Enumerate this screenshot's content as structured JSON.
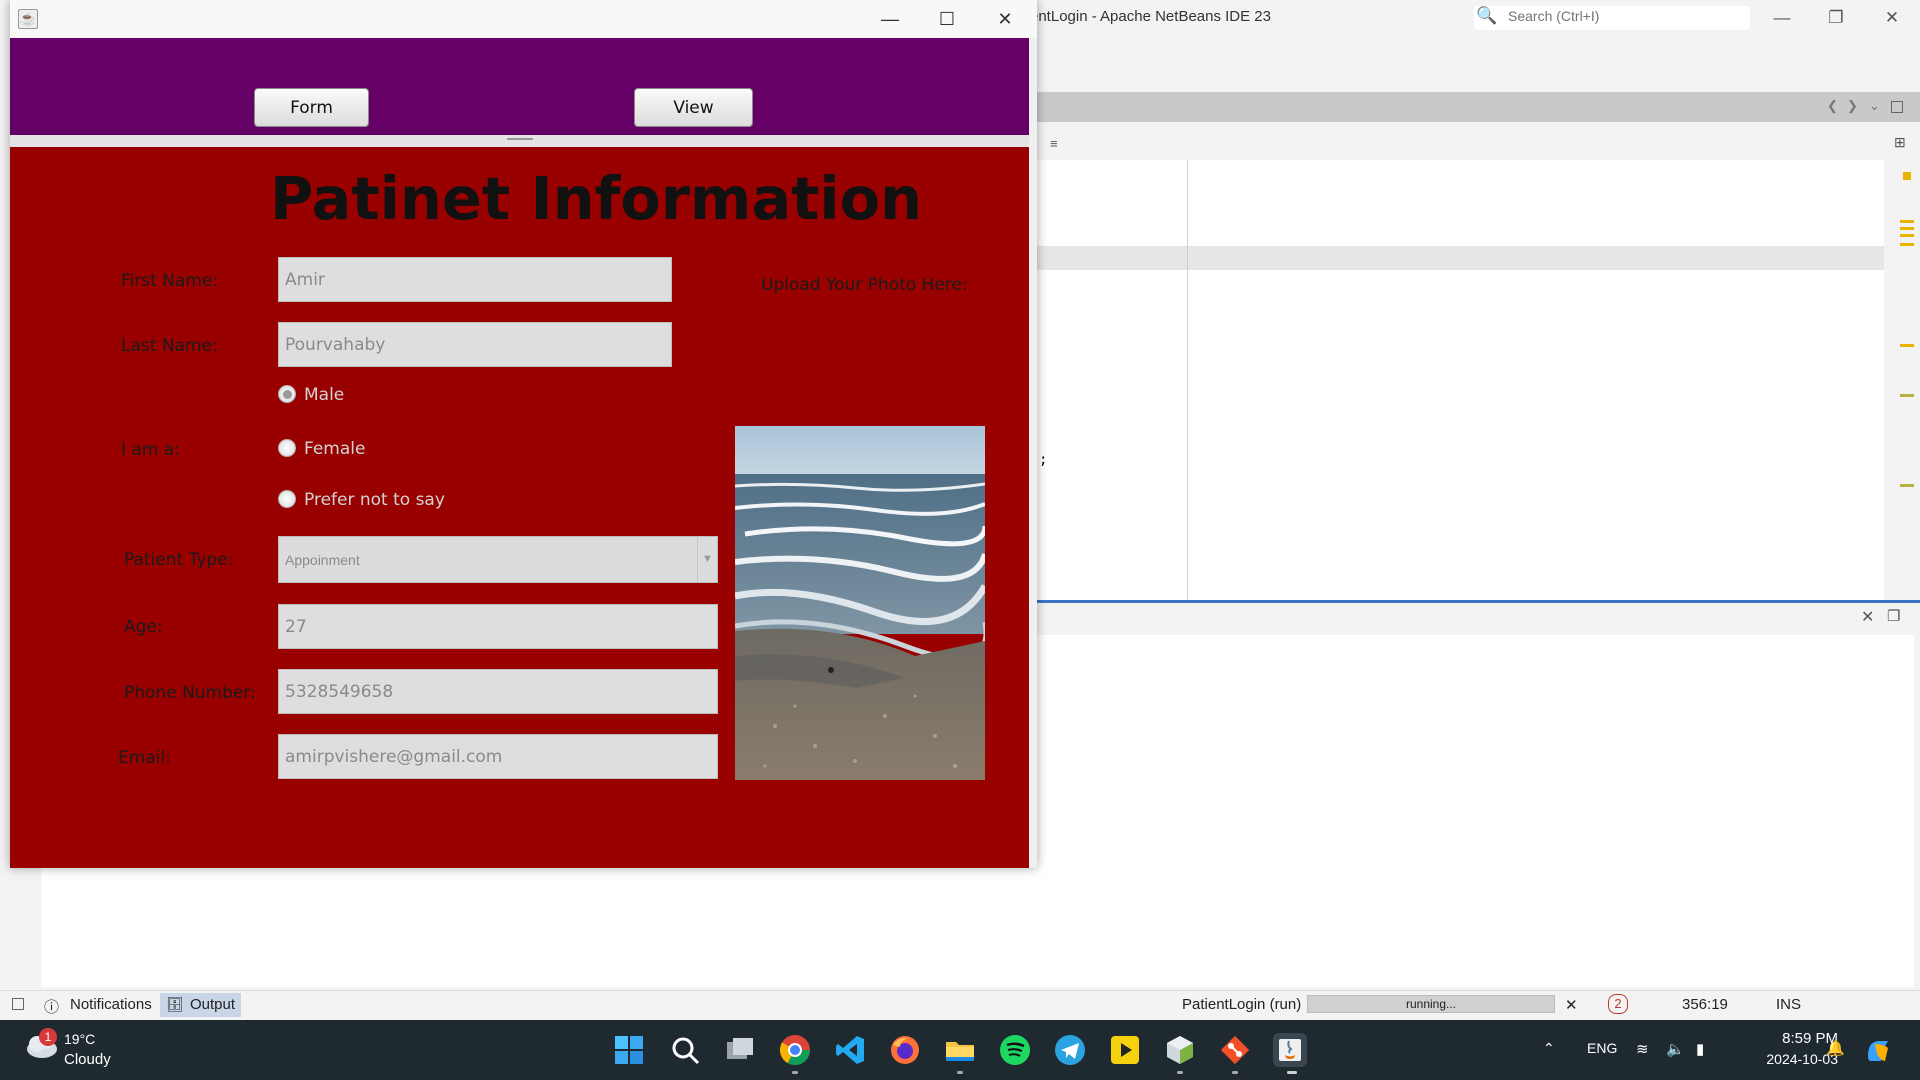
{
  "ide": {
    "title": "entLogin - Apache NetBeans IDE 23",
    "search_placeholder": "Search (Ctrl+I)",
    "editor_fragment": ";",
    "statusbar": {
      "notifications": "Notifications",
      "output": "Output",
      "run_label": "PatientLogin (run)",
      "progress_label": "running...",
      "error_count": "2",
      "cursor_position": "356:19",
      "insert_mode": "INS"
    }
  },
  "taskbar": {
    "weather": {
      "temp": "19°C",
      "desc": "Cloudy",
      "badge": "1"
    },
    "language": "ENG",
    "clock": {
      "time": "8:59 PM",
      "date": "2024-10-03"
    },
    "pinned_apps": [
      "start",
      "search",
      "task-view",
      "chrome",
      "vscode",
      "firefox",
      "file-explorer",
      "spotify",
      "telegram",
      "kmplayer",
      "3d-box-app",
      "git",
      "java"
    ]
  },
  "app": {
    "nav": {
      "form_label": "Form",
      "view_label": "View"
    },
    "form": {
      "title": "Patinet Information",
      "first_name_label": "First Name:",
      "first_name_value": "Amir",
      "last_name_label": "Last Name:",
      "last_name_value": "Pourvahaby",
      "gender_label": "I am a:",
      "gender_options": [
        "Male",
        "Female",
        "Prefer not to say"
      ],
      "gender_selected": "Male",
      "patient_type_label": "Patient Type:",
      "patient_type_value": "Appoinment",
      "age_label": "Age:",
      "age_value": "27",
      "phone_label": "Phone Number:",
      "phone_value": "5328549658",
      "email_label": "Email:",
      "email_value": "amirpvishere@gmail.com",
      "upload_label": "Upload Your Photo Here:"
    }
  },
  "colors": {
    "nav_bg": "#650066",
    "panel_bg": "#990000",
    "taskbar_bg": "#1f2a30",
    "ide_accent": "#3b73c4"
  }
}
